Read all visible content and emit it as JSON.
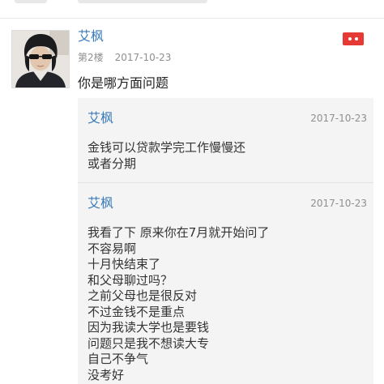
{
  "post": {
    "username": "艾枫",
    "floor": "第2楼",
    "date": "2017-10-23",
    "content": "你是哪方面问题",
    "report_icon": "report-flag-icon",
    "colors": {
      "username": "#3a7bb8",
      "report": "#e53935",
      "reply_bg": "#f4f4f4"
    }
  },
  "replies": [
    {
      "username": "艾枫",
      "date": "2017-10-23",
      "lines": [
        "金钱可以贷款学完工作慢慢还",
        "或者分期"
      ]
    },
    {
      "username": "艾枫",
      "date": "2017-10-23",
      "lines": [
        "我看了下 原来你在7月就开始问了",
        "不容易啊",
        "十月快结束了",
        "和父母聊过吗？",
        "之前父母也是很反对",
        "不过金钱不是重点",
        "因为我读大学也是要钱",
        "问题只是我不想读大专",
        "自己不争气",
        "没考好"
      ]
    }
  ]
}
